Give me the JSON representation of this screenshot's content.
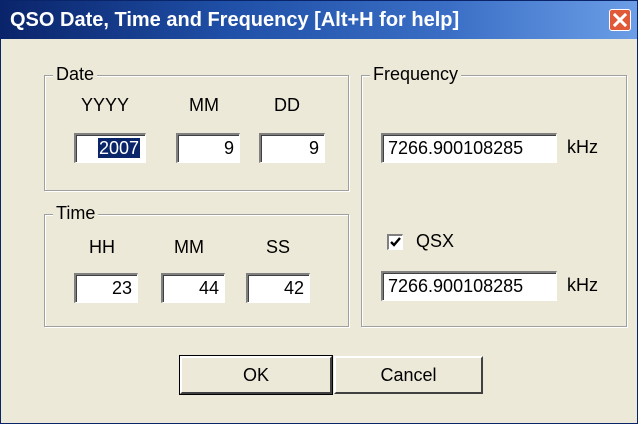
{
  "window": {
    "title": "QSO Date, Time and Frequency [Alt+H for help]"
  },
  "date_group": {
    "label": "Date",
    "year_label": "YYYY",
    "month_label": "MM",
    "day_label": "DD",
    "year_value": "2007",
    "month_value": "9",
    "day_value": "9"
  },
  "time_group": {
    "label": "Time",
    "hour_label": "HH",
    "minute_label": "MM",
    "second_label": "SS",
    "hour_value": "23",
    "minute_value": "44",
    "second_value": "42"
  },
  "frequency_group": {
    "label": "Frequency",
    "frequency_value": "7266.900108285",
    "frequency_unit": "kHz",
    "qsx_label": "QSX",
    "qsx_checked": true,
    "qsx_value": "7266.900108285",
    "qsx_unit": "kHz"
  },
  "buttons": {
    "ok_label": "OK",
    "cancel_label": "Cancel"
  },
  "icons": {
    "close": "close-icon",
    "check": "check-icon"
  },
  "colors": {
    "title_start": "#0a246a",
    "title_end": "#6b9ee6",
    "dialog_bg": "#ece9d8",
    "close_red": "#e05a3a",
    "selection": "#0a246a"
  }
}
